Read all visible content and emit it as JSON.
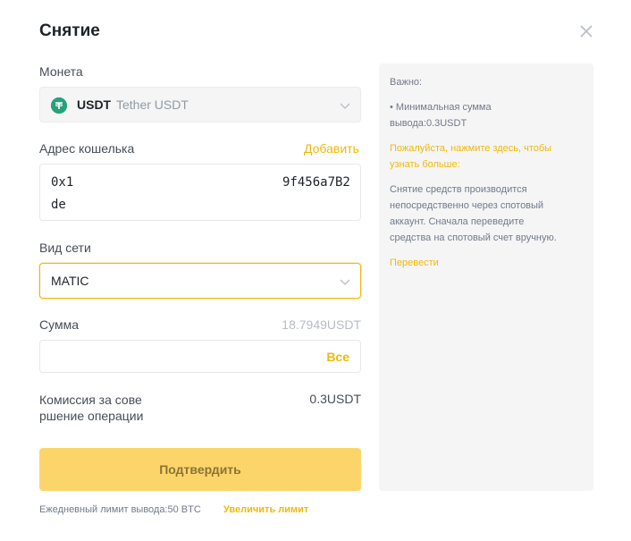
{
  "dialog": {
    "title": "Снятие"
  },
  "coin": {
    "label": "Монета",
    "code": "USDT",
    "name": "Tether USDT",
    "icon": "tether-icon",
    "icon_color": "#26a17b"
  },
  "address": {
    "label": "Адрес кошелька",
    "add_link": "Добавить",
    "line1_start": "0x1",
    "line1_end": "9f456a7B2",
    "line2": "de"
  },
  "network": {
    "label": "Вид сети",
    "value": "MATIC"
  },
  "amount": {
    "label": "Сумма",
    "balance": "18.7949USDT",
    "value": "",
    "placeholder": "",
    "all_button": "Все"
  },
  "fee": {
    "label": "Комиссия за сове­ршение операции",
    "label_line1": "Комиссия за сове",
    "label_line2": "ршение операции",
    "value": "0.3USDT"
  },
  "confirm_button": "Подтвердить",
  "limit": {
    "text": "Ежедневный лимит вывода:50 BTC",
    "link": "Увеличить лимит"
  },
  "info_panel": {
    "heading": "Важно:",
    "min_amount_line1": "• Минимальная сумма",
    "min_amount_line2": "вывода:0.3USDT",
    "learn_more_line1": "Пожалуйста, нажмите здесь, чтобы",
    "learn_more_line2": "узнать больше:",
    "desc_line1": "Снятие средств производится",
    "desc_line2": "непосредственно через спотовый",
    "desc_line3": "аккаунт. Сначала переведите",
    "desc_line4": "средства на спотовый счет вручную.",
    "transfer_link": "Перевести"
  },
  "colors": {
    "accent": "#f0b90b",
    "confirm_disabled": "#fcd56a",
    "panel_bg": "#f5f5f5"
  }
}
